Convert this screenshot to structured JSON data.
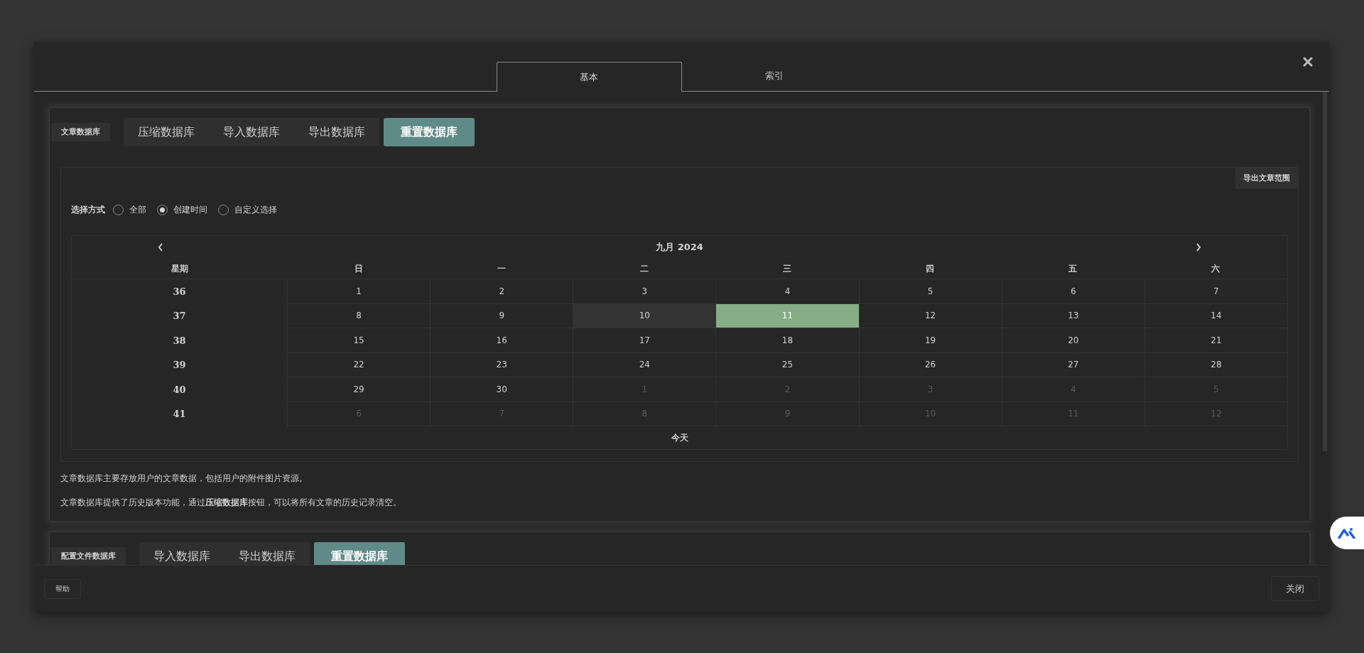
{
  "tabs": [
    {
      "label": "基本",
      "selected": true
    },
    {
      "label": "索引",
      "selected": false
    }
  ],
  "sections": [
    {
      "label": "文章数据库",
      "buttons": [
        {
          "label": "压缩数据库",
          "selected": false
        },
        {
          "label": "导入数据库",
          "selected": false
        },
        {
          "label": "导出数据库",
          "selected": false
        },
        {
          "label": "重置数据库",
          "selected": true
        }
      ],
      "export_button": "导出文章范围",
      "select_mode": {
        "label": "选择方式",
        "options": [
          {
            "label": "全部",
            "selected": false
          },
          {
            "label": "创建时间",
            "selected": true
          },
          {
            "label": "自定义选择",
            "selected": false
          }
        ]
      },
      "calendar": {
        "title": "九月 2024",
        "week_header": "星期",
        "weekdays": [
          "日",
          "一",
          "二",
          "三",
          "四",
          "五",
          "六"
        ],
        "weeks": [
          {
            "week": "36",
            "days": [
              {
                "text": "1",
                "outside": false,
                "selected": false,
                "highlighted": false
              },
              {
                "text": "2",
                "outside": false,
                "selected": false,
                "highlighted": false
              },
              {
                "text": "3",
                "outside": false,
                "selected": false,
                "highlighted": false
              },
              {
                "text": "4",
                "outside": false,
                "selected": false,
                "highlighted": false
              },
              {
                "text": "5",
                "outside": false,
                "selected": false,
                "highlighted": false
              },
              {
                "text": "6",
                "outside": false,
                "selected": false,
                "highlighted": false
              },
              {
                "text": "7",
                "outside": false,
                "selected": false,
                "highlighted": false
              }
            ]
          },
          {
            "week": "37",
            "days": [
              {
                "text": "8",
                "outside": false,
                "selected": false,
                "highlighted": false
              },
              {
                "text": "9",
                "outside": false,
                "selected": false,
                "highlighted": false
              },
              {
                "text": "10",
                "outside": false,
                "selected": false,
                "highlighted": true
              },
              {
                "text": "11",
                "outside": false,
                "selected": true,
                "highlighted": false
              },
              {
                "text": "12",
                "outside": false,
                "selected": false,
                "highlighted": false
              },
              {
                "text": "13",
                "outside": false,
                "selected": false,
                "highlighted": false
              },
              {
                "text": "14",
                "outside": false,
                "selected": false,
                "highlighted": false
              }
            ]
          },
          {
            "week": "38",
            "days": [
              {
                "text": "15",
                "outside": false,
                "selected": false,
                "highlighted": false
              },
              {
                "text": "16",
                "outside": false,
                "selected": false,
                "highlighted": false
              },
              {
                "text": "17",
                "outside": false,
                "selected": false,
                "highlighted": false
              },
              {
                "text": "18",
                "outside": false,
                "selected": false,
                "highlighted": false
              },
              {
                "text": "19",
                "outside": false,
                "selected": false,
                "highlighted": false
              },
              {
                "text": "20",
                "outside": false,
                "selected": false,
                "highlighted": false
              },
              {
                "text": "21",
                "outside": false,
                "selected": false,
                "highlighted": false
              }
            ]
          },
          {
            "week": "39",
            "days": [
              {
                "text": "22",
                "outside": false,
                "selected": false,
                "highlighted": false
              },
              {
                "text": "23",
                "outside": false,
                "selected": false,
                "highlighted": false
              },
              {
                "text": "24",
                "outside": false,
                "selected": false,
                "highlighted": false
              },
              {
                "text": "25",
                "outside": false,
                "selected": false,
                "highlighted": false
              },
              {
                "text": "26",
                "outside": false,
                "selected": false,
                "highlighted": false
              },
              {
                "text": "27",
                "outside": false,
                "selected": false,
                "highlighted": false
              },
              {
                "text": "28",
                "outside": false,
                "selected": false,
                "highlighted": false
              }
            ]
          },
          {
            "week": "40",
            "days": [
              {
                "text": "29",
                "outside": false,
                "selected": false,
                "highlighted": false
              },
              {
                "text": "30",
                "outside": false,
                "selected": false,
                "highlighted": false
              },
              {
                "text": "1",
                "outside": true,
                "selected": false,
                "highlighted": false
              },
              {
                "text": "2",
                "outside": true,
                "selected": false,
                "highlighted": false
              },
              {
                "text": "3",
                "outside": true,
                "selected": false,
                "highlighted": false
              },
              {
                "text": "4",
                "outside": true,
                "selected": false,
                "highlighted": false
              },
              {
                "text": "5",
                "outside": true,
                "selected": false,
                "highlighted": false
              }
            ]
          },
          {
            "week": "41",
            "days": [
              {
                "text": "6",
                "outside": true,
                "selected": false,
                "highlighted": false
              },
              {
                "text": "7",
                "outside": true,
                "selected": false,
                "highlighted": false
              },
              {
                "text": "8",
                "outside": true,
                "selected": false,
                "highlighted": false
              },
              {
                "text": "9",
                "outside": true,
                "selected": false,
                "highlighted": false
              },
              {
                "text": "10",
                "outside": true,
                "selected": false,
                "highlighted": false
              },
              {
                "text": "11",
                "outside": true,
                "selected": false,
                "highlighted": false
              },
              {
                "text": "12",
                "outside": true,
                "selected": false,
                "highlighted": false
              }
            ]
          }
        ],
        "today": "今天"
      },
      "notes": [
        "文章数据库主要存放用户的文章数据，包括用户的附件图片资源。",
        "文章数据库提供了历史版本功能，通过**压缩数据库**按钮，可以将所有文章的历史记录清空。"
      ]
    },
    {
      "label": "配置文件数据库",
      "buttons": [
        {
          "label": "导入数据库",
          "selected": false
        },
        {
          "label": "导出数据库",
          "selected": false
        },
        {
          "label": "重置数据库",
          "selected": true
        }
      ]
    }
  ],
  "footer": {
    "help": "帮助",
    "close": "关闭"
  }
}
